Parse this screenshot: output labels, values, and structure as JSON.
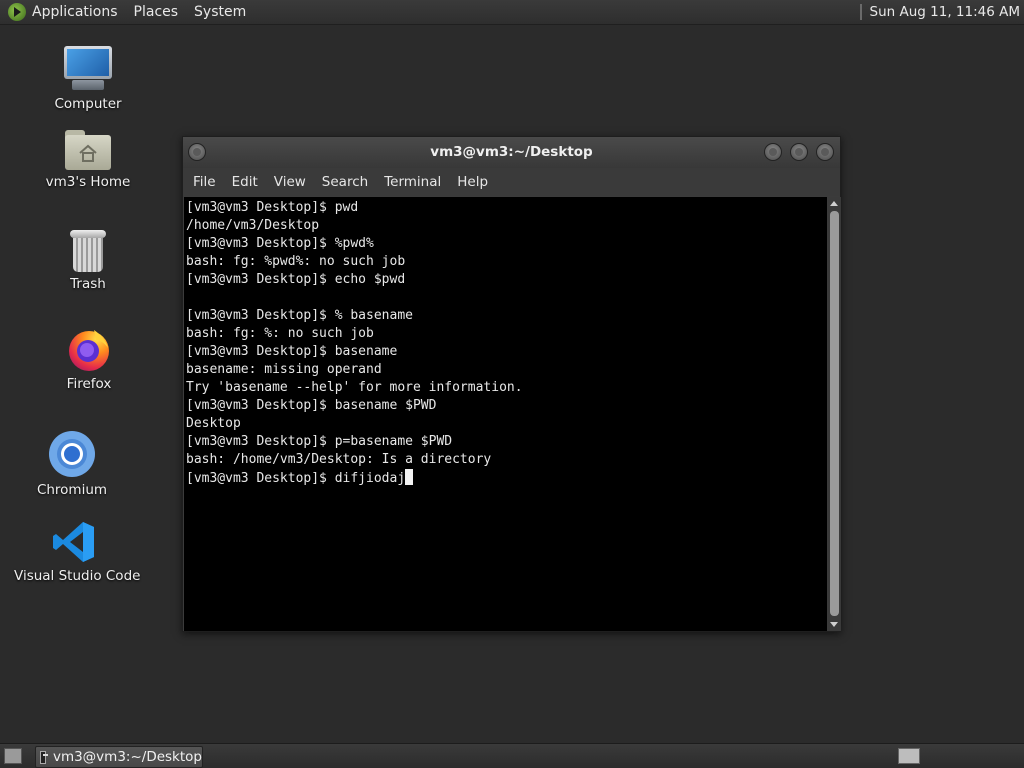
{
  "top_panel": {
    "menus": [
      "Applications",
      "Places",
      "System"
    ],
    "clock": "Sun Aug 11, 11:46 AM"
  },
  "desktop_icons": [
    {
      "label": "Computer",
      "icon": "computer-icon"
    },
    {
      "label": "vm3's Home",
      "icon": "home-folder-icon"
    },
    {
      "label": "Trash",
      "icon": "trash-icon"
    },
    {
      "label": "Firefox",
      "icon": "firefox-icon"
    },
    {
      "label": "Chromium",
      "icon": "chromium-icon"
    },
    {
      "label": "Visual Studio Code",
      "icon": "vscode-icon"
    }
  ],
  "terminal": {
    "title": "vm3@vm3:~/Desktop",
    "menu": [
      "File",
      "Edit",
      "View",
      "Search",
      "Terminal",
      "Help"
    ],
    "lines": [
      "[vm3@vm3 Desktop]$ pwd",
      "/home/vm3/Desktop",
      "[vm3@vm3 Desktop]$ %pwd%",
      "bash: fg: %pwd%: no such job",
      "[vm3@vm3 Desktop]$ echo $pwd",
      "",
      "[vm3@vm3 Desktop]$ % basename",
      "bash: fg: %: no such job",
      "[vm3@vm3 Desktop]$ basename",
      "basename: missing operand",
      "Try 'basename --help' for more information.",
      "[vm3@vm3 Desktop]$ basename $PWD",
      "Desktop",
      "[vm3@vm3 Desktop]$ p=basename $PWD",
      "bash: /home/vm3/Desktop: Is a directory"
    ],
    "prompt_line": "[vm3@vm3 Desktop]$ difjiodaj"
  },
  "taskbar": {
    "window_button": "vm3@vm3:~/Desktop"
  },
  "colors": {
    "desktop_bg": "#2b2b2b",
    "terminal_bg": "#000000",
    "terminal_fg": "#e8e8e8"
  }
}
